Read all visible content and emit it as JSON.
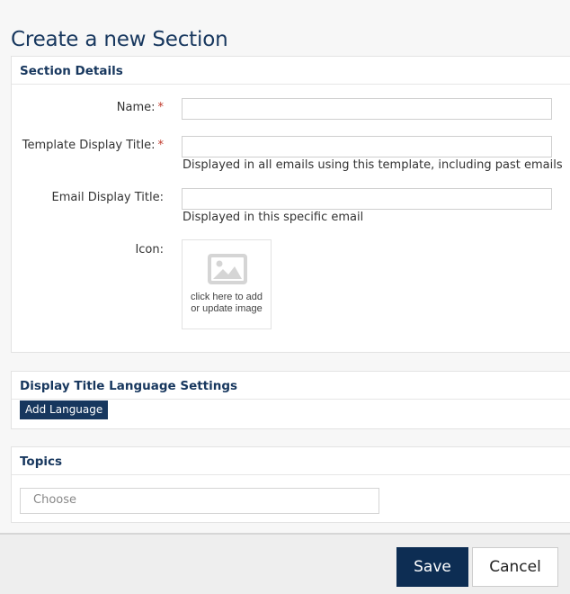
{
  "page": {
    "title": "Create a new Section"
  },
  "section_details": {
    "heading": "Section Details",
    "name": {
      "label": "Name:",
      "required": "*",
      "value": ""
    },
    "template_display_title": {
      "label": "Template Display Title:",
      "required": "*",
      "value": "",
      "help": "Displayed in all emails using this template, including past emails"
    },
    "email_display_title": {
      "label": "Email Display Title:",
      "value": "",
      "help": "Displayed in this specific email"
    },
    "icon": {
      "label": "Icon:",
      "placeholder_line1": "click here to add",
      "placeholder_line2": "or update image",
      "icon_name": "image-placeholder-icon"
    }
  },
  "language_settings": {
    "heading": "Display Title Language Settings",
    "add_button": "Add Language"
  },
  "topics": {
    "heading": "Topics",
    "placeholder": "Choose"
  },
  "footer": {
    "save_label": "Save",
    "cancel_label": "Cancel"
  },
  "colors": {
    "primary": "#17375e",
    "save_button": "#0d2d53",
    "required": "#c0392b"
  }
}
